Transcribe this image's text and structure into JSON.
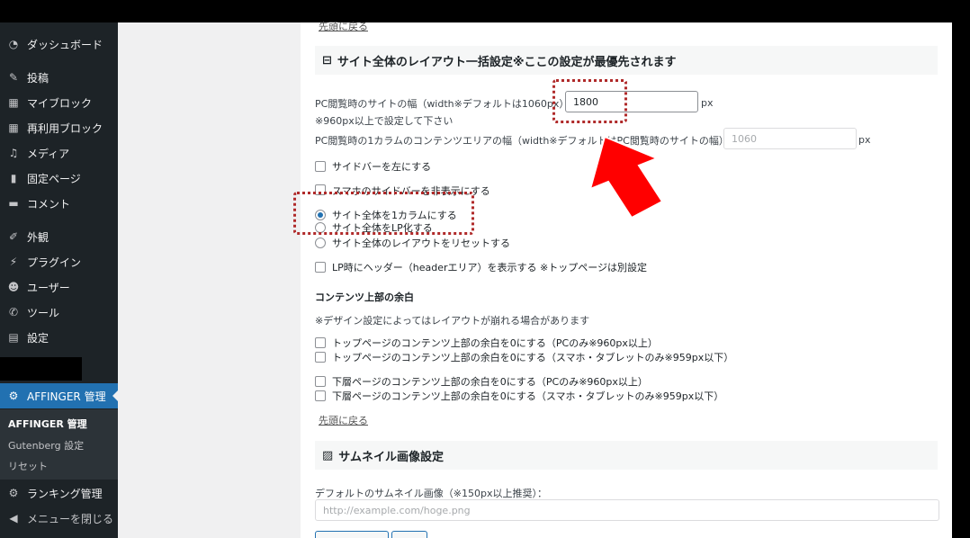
{
  "sidebar": {
    "items": [
      {
        "label": "ダッシュボード",
        "icon": "dashboard-icon"
      },
      {
        "label": "投稿",
        "icon": "pin-icon"
      },
      {
        "label": "マイブロック",
        "icon": "blocks-icon"
      },
      {
        "label": "再利用ブロック",
        "icon": "blocks-icon"
      },
      {
        "label": "メディア",
        "icon": "media-icon"
      },
      {
        "label": "固定ページ",
        "icon": "page-icon"
      },
      {
        "label": "コメント",
        "icon": "comment-icon"
      },
      {
        "label": "外観",
        "icon": "brush-icon"
      },
      {
        "label": "プラグイン",
        "icon": "plugin-icon"
      },
      {
        "label": "ユーザー",
        "icon": "user-icon"
      },
      {
        "label": "ツール",
        "icon": "wrench-icon"
      },
      {
        "label": "設定",
        "icon": "settings-icon"
      }
    ],
    "active": {
      "label": "AFFINGER 管理",
      "icon": "gear-icon"
    },
    "submenu": [
      "AFFINGER 管理",
      "Gutenberg 設定",
      "リセット"
    ],
    "after": [
      {
        "label": "ランキング管理",
        "icon": "gear-icon"
      },
      {
        "label": "メニューを閉じる",
        "icon": "collapse-icon"
      }
    ]
  },
  "main": {
    "top_link": "先頭に戻る",
    "layout_section": {
      "title": "サイト全体のレイアウト一括設定※ここの設定が最優先されます",
      "width_label": "PC閲覧時のサイトの幅（width※デフォルトは1060px）：",
      "width_value": "1800",
      "width_unit": "px",
      "width_note": "※960px以上で設定して下さい",
      "one_col_label": "PC閲覧時の1カラムのコンテンツエリアの幅（width※デフォルトはPC閲覧時のサイトの幅）：",
      "one_col_placeholder": "1060",
      "one_col_unit": "px",
      "opt_sidebar_left": "サイドバーを左にする",
      "opt_sp_sidebar_hide": "スマホのサイドバーを非表示にする",
      "opt_one_column": "サイト全体を1カラムにする",
      "opt_lp": "サイト全体をLP化する",
      "opt_reset": "サイト全体のレイアウトをリセットする",
      "opt_lp_header": "LP時にヘッダー（headerエリア）を表示する ※トップページは別設定"
    },
    "margin_section": {
      "title": "コンテンツ上部の余白",
      "note": "※デザイン設定によってはレイアウトが崩れる場合があります",
      "opts": [
        "トップページのコンテンツ上部の余白を0にする（PCのみ※960px以上）",
        "トップページのコンテンツ上部の余白を0にする（スマホ・タブレットのみ※959px以下）",
        "下層ページのコンテンツ上部の余白を0にする（PCのみ※960px以上）",
        "下層ページのコンテンツ上部の余白を0にする（スマホ・タブレットのみ※959px以下）"
      ],
      "back_link": "先頭に戻る"
    },
    "thumb_section": {
      "title": "サムネイル画像設定",
      "default_label": "デフォルトのサムネイル画像（※150px以上推奨）：",
      "default_placeholder": "http://example.com/hoge.png"
    }
  },
  "colors": {
    "annotation": "#b02a2a",
    "arrow": "#ff0000",
    "accent": "#2271b1"
  }
}
